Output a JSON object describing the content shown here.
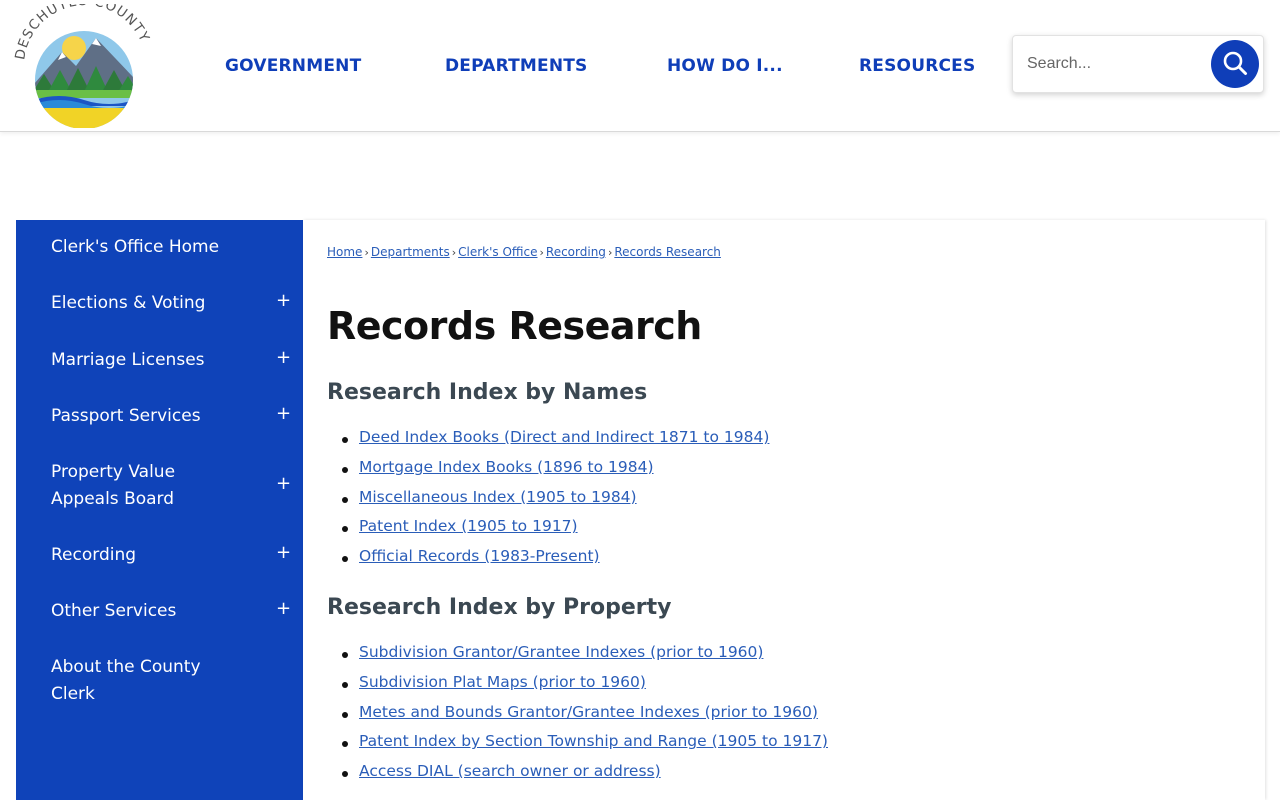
{
  "header": {
    "logo_text": "DESCHUTES COUNTY",
    "nav": [
      "GOVERNMENT",
      "DEPARTMENTS",
      "HOW DO I...",
      "RESOURCES"
    ],
    "search": {
      "placeholder": "Search..."
    },
    "colors": {
      "nav": "#0f3eb8",
      "search_button": "#0f3eb8"
    }
  },
  "sidebar": {
    "background": "#0f43b9",
    "items": [
      {
        "label": "Clerk's Office Home",
        "expandable": false
      },
      {
        "label": "Elections & Voting",
        "expandable": true
      },
      {
        "label": "Marriage Licenses",
        "expandable": true
      },
      {
        "label": "Passport Services",
        "expandable": true
      },
      {
        "label": "Property Value Appeals Board",
        "expandable": true
      },
      {
        "label": "Recording",
        "expandable": true
      },
      {
        "label": "Other Services",
        "expandable": true
      },
      {
        "label": "About the County Clerk",
        "expandable": false
      }
    ],
    "expand_symbol": "+"
  },
  "breadcrumb": [
    "Home",
    "Departments",
    "Clerk's Office",
    "Recording",
    "Records Research"
  ],
  "breadcrumb_separator": "›",
  "main": {
    "title": "Records Research",
    "sections": [
      {
        "heading": "Research Index by Names",
        "links": [
          "Deed Index Books (Direct and Indirect 1871 to 1984)",
          "Mortgage Index Books (1896 to 1984)",
          "Miscellaneous Index (1905 to 1984)",
          "Patent Index (1905 to 1917)",
          "Official Records (1983-Present)"
        ]
      },
      {
        "heading": "Research Index by Property",
        "links": [
          "Subdivision Grantor/Grantee Indexes (prior to 1960)",
          "Subdivision Plat Maps (prior to 1960)",
          "Metes and Bounds Grantor/Grantee Indexes (prior to 1960)",
          "Patent Index by Section Township and Range (1905 to 1917)",
          "Access DIAL (search owner or address)"
        ]
      }
    ],
    "link_color": "#2a5db8"
  }
}
